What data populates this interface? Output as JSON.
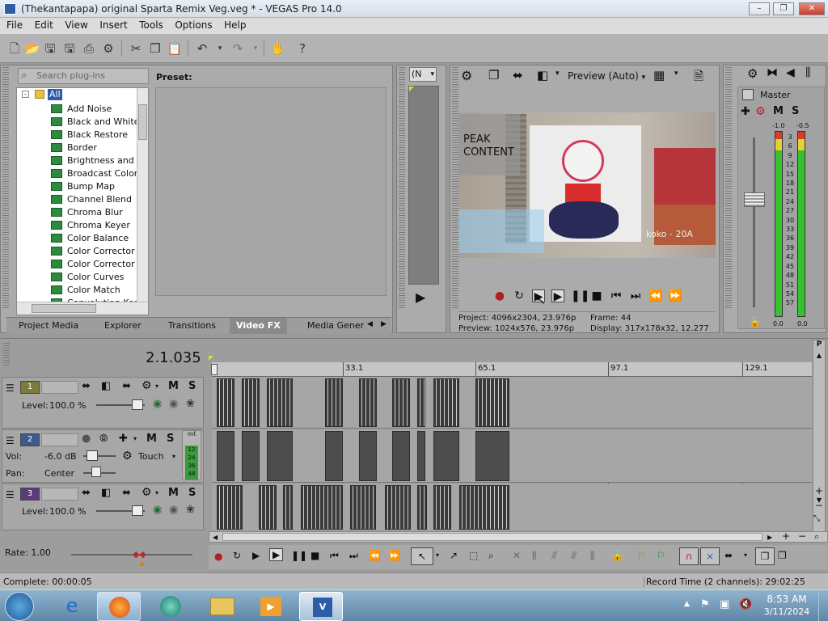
{
  "window": {
    "title": "(Thekantapapa) original Sparta Remix Veg.veg * - VEGAS Pro 14.0",
    "min": "–",
    "max": "❐",
    "close": "✕"
  },
  "menu": [
    "File",
    "Edit",
    "View",
    "Insert",
    "Tools",
    "Options",
    "Help"
  ],
  "plugins": {
    "search_placeholder": "Search plug-ins",
    "root": "All",
    "preset_label": "Preset:",
    "items": [
      "Add Noise",
      "Black and White",
      "Black Restore",
      "Border",
      "Brightness and Co",
      "Broadcast Colors",
      "Bump Map",
      "Channel Blend",
      "Chroma Blur",
      "Chroma Keyer",
      "Color Balance",
      "Color Corrector",
      "Color Corrector (S",
      "Color Curves",
      "Color Match",
      "Convolution Kerne"
    ]
  },
  "tabs": [
    "Project Media",
    "Explorer",
    "Transitions",
    "Video FX",
    "Media Genera"
  ],
  "trimmer": {
    "dropdown": "(N"
  },
  "preview": {
    "mode": "Preview (Auto)",
    "overlay_line1": "PEAK",
    "overlay_line2": "CONTENT",
    "overlay_watermark": "koko - 20A",
    "project_label": "Project:",
    "project_value": "4096x2304, 23.976p",
    "preview_label": "Preview:",
    "preview_value": "1024x576, 23.976p",
    "frame_label": "Frame:",
    "frame_value": "44",
    "display_label": "Display:",
    "display_value": "317x178x32, 12.277"
  },
  "master": {
    "label": "Master",
    "m": "M",
    "s": "S",
    "peak_left": "-1.0",
    "peak_right": "-0.5",
    "scale": [
      "3",
      "6",
      "9",
      "12",
      "15",
      "18",
      "21",
      "24",
      "27",
      "30",
      "33",
      "36",
      "39",
      "42",
      "45",
      "48",
      "51",
      "54",
      "57"
    ],
    "bottom_left": "0.0",
    "bottom_right": "0.0"
  },
  "timeline": {
    "time": "2.1.035",
    "markers": [
      "33.1",
      "65.1",
      "97.1",
      "129.1"
    ]
  },
  "tracks": [
    {
      "num": "1",
      "level_label": "Level:",
      "level": "100.0 %",
      "m": "M",
      "s": "S"
    },
    {
      "num": "2",
      "vol_label": "Vol:",
      "vol": "-6.0 dB",
      "pan_label": "Pan:",
      "pan": "Center",
      "mode": "Touch",
      "m": "M",
      "s": "S",
      "meter_inf": "-Inf.",
      "meter_vals": [
        "12",
        "24",
        "36",
        "48"
      ]
    },
    {
      "num": "3",
      "level_label": "Level:",
      "level": "100.0 %",
      "m": "M",
      "s": "S"
    }
  ],
  "rate": "Rate: 1.00",
  "status": {
    "left": "Complete: 00:00:05",
    "right": "Record Time (2 channels): 29:02:25"
  },
  "taskbar": {
    "time": "8:53 AM",
    "date": "3/11/2024"
  },
  "colors": {
    "accent": "#2c5ea8",
    "meter_green": "#34c22e"
  }
}
